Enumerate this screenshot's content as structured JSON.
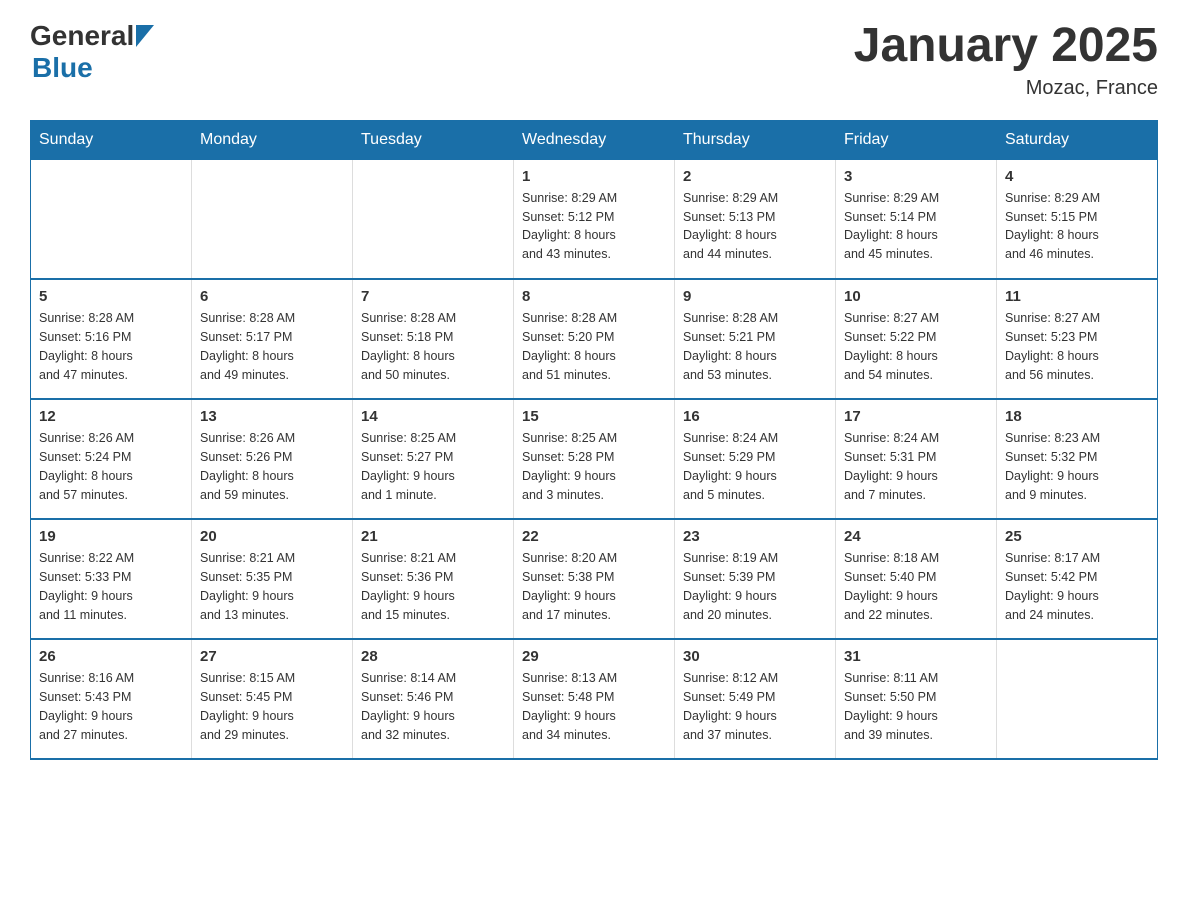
{
  "logo": {
    "text_general": "General",
    "text_blue": "Blue",
    "line2": "Blue"
  },
  "calendar": {
    "title": "January 2025",
    "subtitle": "Mozac, France",
    "days_of_week": [
      "Sunday",
      "Monday",
      "Tuesday",
      "Wednesday",
      "Thursday",
      "Friday",
      "Saturday"
    ],
    "weeks": [
      [
        {
          "day": "",
          "info": ""
        },
        {
          "day": "",
          "info": ""
        },
        {
          "day": "",
          "info": ""
        },
        {
          "day": "1",
          "info": "Sunrise: 8:29 AM\nSunset: 5:12 PM\nDaylight: 8 hours\nand 43 minutes."
        },
        {
          "day": "2",
          "info": "Sunrise: 8:29 AM\nSunset: 5:13 PM\nDaylight: 8 hours\nand 44 minutes."
        },
        {
          "day": "3",
          "info": "Sunrise: 8:29 AM\nSunset: 5:14 PM\nDaylight: 8 hours\nand 45 minutes."
        },
        {
          "day": "4",
          "info": "Sunrise: 8:29 AM\nSunset: 5:15 PM\nDaylight: 8 hours\nand 46 minutes."
        }
      ],
      [
        {
          "day": "5",
          "info": "Sunrise: 8:28 AM\nSunset: 5:16 PM\nDaylight: 8 hours\nand 47 minutes."
        },
        {
          "day": "6",
          "info": "Sunrise: 8:28 AM\nSunset: 5:17 PM\nDaylight: 8 hours\nand 49 minutes."
        },
        {
          "day": "7",
          "info": "Sunrise: 8:28 AM\nSunset: 5:18 PM\nDaylight: 8 hours\nand 50 minutes."
        },
        {
          "day": "8",
          "info": "Sunrise: 8:28 AM\nSunset: 5:20 PM\nDaylight: 8 hours\nand 51 minutes."
        },
        {
          "day": "9",
          "info": "Sunrise: 8:28 AM\nSunset: 5:21 PM\nDaylight: 8 hours\nand 53 minutes."
        },
        {
          "day": "10",
          "info": "Sunrise: 8:27 AM\nSunset: 5:22 PM\nDaylight: 8 hours\nand 54 minutes."
        },
        {
          "day": "11",
          "info": "Sunrise: 8:27 AM\nSunset: 5:23 PM\nDaylight: 8 hours\nand 56 minutes."
        }
      ],
      [
        {
          "day": "12",
          "info": "Sunrise: 8:26 AM\nSunset: 5:24 PM\nDaylight: 8 hours\nand 57 minutes."
        },
        {
          "day": "13",
          "info": "Sunrise: 8:26 AM\nSunset: 5:26 PM\nDaylight: 8 hours\nand 59 minutes."
        },
        {
          "day": "14",
          "info": "Sunrise: 8:25 AM\nSunset: 5:27 PM\nDaylight: 9 hours\nand 1 minute."
        },
        {
          "day": "15",
          "info": "Sunrise: 8:25 AM\nSunset: 5:28 PM\nDaylight: 9 hours\nand 3 minutes."
        },
        {
          "day": "16",
          "info": "Sunrise: 8:24 AM\nSunset: 5:29 PM\nDaylight: 9 hours\nand 5 minutes."
        },
        {
          "day": "17",
          "info": "Sunrise: 8:24 AM\nSunset: 5:31 PM\nDaylight: 9 hours\nand 7 minutes."
        },
        {
          "day": "18",
          "info": "Sunrise: 8:23 AM\nSunset: 5:32 PM\nDaylight: 9 hours\nand 9 minutes."
        }
      ],
      [
        {
          "day": "19",
          "info": "Sunrise: 8:22 AM\nSunset: 5:33 PM\nDaylight: 9 hours\nand 11 minutes."
        },
        {
          "day": "20",
          "info": "Sunrise: 8:21 AM\nSunset: 5:35 PM\nDaylight: 9 hours\nand 13 minutes."
        },
        {
          "day": "21",
          "info": "Sunrise: 8:21 AM\nSunset: 5:36 PM\nDaylight: 9 hours\nand 15 minutes."
        },
        {
          "day": "22",
          "info": "Sunrise: 8:20 AM\nSunset: 5:38 PM\nDaylight: 9 hours\nand 17 minutes."
        },
        {
          "day": "23",
          "info": "Sunrise: 8:19 AM\nSunset: 5:39 PM\nDaylight: 9 hours\nand 20 minutes."
        },
        {
          "day": "24",
          "info": "Sunrise: 8:18 AM\nSunset: 5:40 PM\nDaylight: 9 hours\nand 22 minutes."
        },
        {
          "day": "25",
          "info": "Sunrise: 8:17 AM\nSunset: 5:42 PM\nDaylight: 9 hours\nand 24 minutes."
        }
      ],
      [
        {
          "day": "26",
          "info": "Sunrise: 8:16 AM\nSunset: 5:43 PM\nDaylight: 9 hours\nand 27 minutes."
        },
        {
          "day": "27",
          "info": "Sunrise: 8:15 AM\nSunset: 5:45 PM\nDaylight: 9 hours\nand 29 minutes."
        },
        {
          "day": "28",
          "info": "Sunrise: 8:14 AM\nSunset: 5:46 PM\nDaylight: 9 hours\nand 32 minutes."
        },
        {
          "day": "29",
          "info": "Sunrise: 8:13 AM\nSunset: 5:48 PM\nDaylight: 9 hours\nand 34 minutes."
        },
        {
          "day": "30",
          "info": "Sunrise: 8:12 AM\nSunset: 5:49 PM\nDaylight: 9 hours\nand 37 minutes."
        },
        {
          "day": "31",
          "info": "Sunrise: 8:11 AM\nSunset: 5:50 PM\nDaylight: 9 hours\nand 39 minutes."
        },
        {
          "day": "",
          "info": ""
        }
      ]
    ]
  }
}
